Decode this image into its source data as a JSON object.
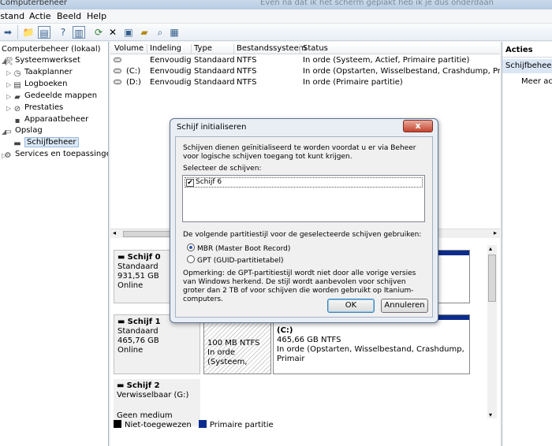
{
  "window": {
    "title_fragment": "Computerbeheer",
    "bg_title_fragment": "Even na dat ik het scherm geplakt heb  ik je dus onderdaan"
  },
  "menu": [
    "Bestand",
    "Actie",
    "Beeld",
    "Help"
  ],
  "toolbar": {
    "icons": [
      "back-icon",
      "up-folder-icon",
      "show-hide-console-tree-icon",
      "help-icon",
      "show-hide-action-pane-icon",
      "refresh-icon",
      "delete-icon",
      "properties-icon",
      "open-folder-icon",
      "search-icon",
      "export-icon"
    ]
  },
  "tree": {
    "items": [
      {
        "label": "Computerbeheer (lokaal)",
        "icon": "computer-icon"
      },
      {
        "label": "Systeemwerkset",
        "icon": "tools-icon"
      },
      {
        "label": "Taakplanner",
        "icon": "clock-icon"
      },
      {
        "label": "Logboeken",
        "icon": "log-icon"
      },
      {
        "label": "Gedeelde mappen",
        "icon": "shared-folder-icon"
      },
      {
        "label": "Prestaties",
        "icon": "performance-icon"
      },
      {
        "label": "Apparaatbeheer",
        "icon": "device-icon"
      },
      {
        "label": "Opslag",
        "icon": "storage-icon"
      },
      {
        "label": "Schijfbeheer",
        "icon": "disk-icon"
      },
      {
        "label": "Services en toepassingen",
        "icon": "services-icon"
      }
    ]
  },
  "volumes": {
    "columns": [
      "Volume",
      "Indeling",
      "Type",
      "Bestandssysteem",
      "Status"
    ],
    "rows": [
      {
        "volume": "",
        "indeling": "Eenvoudig",
        "type": "Standaard",
        "fs": "NTFS",
        "status": "In orde (Systeem, Actief, Primaire partitie)"
      },
      {
        "volume": "(C:)",
        "indeling": "Eenvoudig",
        "type": "Standaard",
        "fs": "NTFS",
        "status": "In orde (Opstarten, Wisselbestand, Crashdump, Primaire p"
      },
      {
        "volume": "(D:)",
        "indeling": "Eenvoudig",
        "type": "Standaard",
        "fs": "NTFS",
        "status": "In orde (Primaire partitie)"
      }
    ]
  },
  "disks": [
    {
      "name": "Schijf 0",
      "type": "Standaard",
      "size": "931,51 GB",
      "state": "Online"
    },
    {
      "name": "Schijf 1",
      "type": "Standaard",
      "size": "465,76 GB",
      "state": "Online",
      "partitions": [
        {
          "label": "",
          "size": "100 MB NTFS",
          "status": "In orde (Systeem,"
        },
        {
          "label": "(C:)",
          "size": "465,66 GB NTFS",
          "status": "In orde (Opstarten, Wisselbestand, Crashdump, Primair"
        }
      ]
    },
    {
      "name": "Schijf 2",
      "type": "Verwisselbaar (G:)",
      "size": "",
      "state": "Geen medium"
    }
  ],
  "legend": [
    {
      "label": "Niet-toegewezen",
      "color": "#000000"
    },
    {
      "label": "Primaire partitie",
      "color": "#0b2c8c"
    }
  ],
  "actions": {
    "header": "Acties",
    "selected": "Schijfbeheer",
    "more": "Meer acties"
  },
  "dialog": {
    "title": "Schijf initialiseren",
    "close": "x",
    "intro": "Schijven dienen geïnitialiseerd te worden voordat u er via Beheer voor logische schijven toegang tot kunt krijgen.",
    "select_label": "Selecteer de schijven:",
    "disks": [
      {
        "label": "Schijf 6",
        "checked": true
      }
    ],
    "style_label": "De volgende partitiestijl voor de geselecteerde schijven gebruiken:",
    "options": [
      {
        "label": "MBR (Master Boot Record)",
        "selected": true
      },
      {
        "label": "GPT (GUID-partitietabel)",
        "selected": false
      }
    ],
    "note": "Opmerking: de GPT-partitiestijl wordt niet door alle vorige versies van Windows herkend. De stijl wordt aanbevolen voor schijven groter dan 2 TB of voor schijven die worden gebruikt op Itanium-computers.",
    "ok": "OK",
    "cancel": "Annuleren"
  }
}
